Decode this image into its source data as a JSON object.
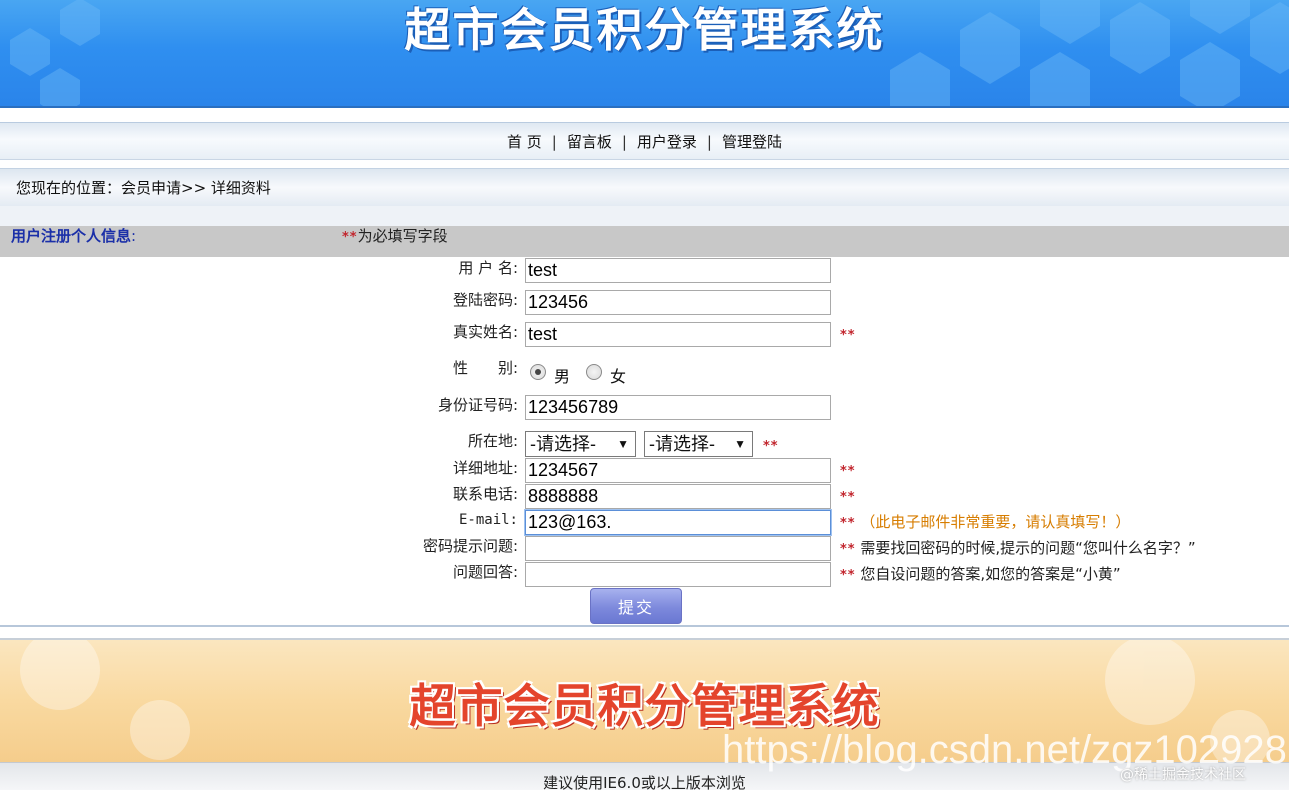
{
  "header": {
    "title": "超市会员积分管理系统"
  },
  "nav": {
    "items": [
      {
        "label": "首 页"
      },
      {
        "label": "留言板"
      },
      {
        "label": "用户登录"
      },
      {
        "label": "管理登陆"
      }
    ],
    "separator": "|"
  },
  "breadcrumb": {
    "text": "您现在的位置：会员申请>> 详细资料"
  },
  "section": {
    "title": "用户注册个人信息",
    "colon": ":",
    "required_mark": "**",
    "required_note": "为必填写字段"
  },
  "form": {
    "username": {
      "label": "用 户 名:",
      "value": "test"
    },
    "password": {
      "label": "登陆密码:",
      "value": "123456"
    },
    "realname": {
      "label": "真实姓名:",
      "value": "test",
      "mark": "**"
    },
    "gender": {
      "label": "性　　别:",
      "male": "男",
      "female": "女",
      "selected": "男"
    },
    "idcard": {
      "label": "身份证号码:",
      "value": "123456789"
    },
    "location": {
      "label": "所在地:",
      "select1": "-请选择-",
      "select2": "-请选择-",
      "mark": "**"
    },
    "address": {
      "label": "详细地址:",
      "value": "1234567",
      "mark": "**"
    },
    "phone": {
      "label": "联系电话:",
      "value": "8888888",
      "mark": "**"
    },
    "email": {
      "label": "E-mail:",
      "value": "123@163.",
      "mark": "**",
      "hint": "（此电子邮件非常重要，请认真填写！）"
    },
    "question": {
      "label": "密码提示问题:",
      "value": "",
      "mark": "**",
      "hint": "需要找回密码的时候,提示的问题“您叫什么名字？”"
    },
    "answer": {
      "label": "问题回答:",
      "value": "",
      "mark": "**",
      "hint": "您自设问题的答案,如您的答案是“小黄”"
    },
    "submit_label": "提交"
  },
  "footer": {
    "banner_title": "超市会员积分管理系统",
    "note": "建议使用IE6.0或以上版本浏览"
  },
  "watermark": {
    "url": "https://blog.csdn.net/zgz102928",
    "site": "@稀土掘金技术社区"
  },
  "colors": {
    "header_blue": "#2f8ff0",
    "section_title": "#1a2fa8",
    "required_red": "#c2262e",
    "footer_title": "#e4442c",
    "submit_purple": "#7d89dc"
  }
}
